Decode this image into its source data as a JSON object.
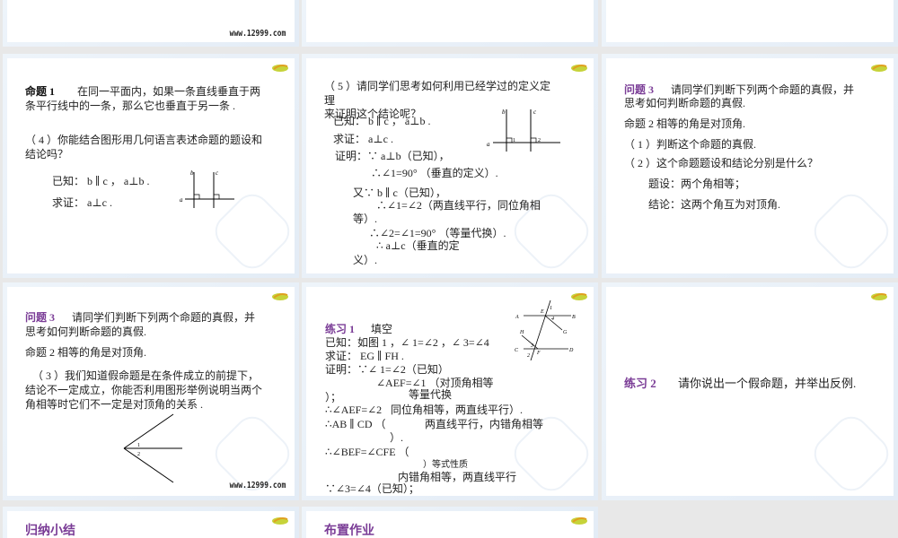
{
  "slides": [
    {
      "site": "www.12999.com"
    },
    {},
    {},
    {
      "title": "命题 1",
      "text1": "在同一平面内，如果一条直线垂直于两",
      "text2": "条平行线中的一条，那么它也垂直于另一条 .",
      "q1": "（ 4 ）你能结合图形用几何语言表述命题的题设和",
      "q2": "结论吗？",
      "known": "已知： b ∥ c ，   a⊥b .",
      "prove": "求证： a⊥c .",
      "labels": [
        "b",
        "c",
        "a"
      ]
    },
    {
      "l1": "（ 5 ）请同学们思考如何利用已经学过的定义定",
      "l2": "理",
      "l3": "来证明这个结论呢？",
      "known": "已知： b ∥ c ， a⊥b .",
      "prove": "求证： a⊥c .",
      "p1": "证明：∵ a⊥b（已知），",
      "p2": "∴∠1=90°  （垂直的定义）.",
      "p3": "又∵ b ∥ c（已知），",
      "p4": "∴∠1=∠2（两直线平行，同位角相",
      "p5": "等）.",
      "p6": "∴∠2=∠1=90° （等量代换）.",
      "p7": "∴ a⊥c（垂直的定",
      "p8": "义）.",
      "labels": [
        "b",
        "c",
        "a",
        "1",
        "2"
      ]
    },
    {
      "title": "问题 3",
      "t1": "请同学们判断下列两个命题的真假，并",
      "t2": "思考如何判断命题的真假.",
      "prop": "命题 2  相等的角是对顶角.",
      "q1": "（ 1 ）判断这个命题的真假.",
      "q2": "（ 2 ）这个命题题设和结论分别是什么？",
      "h": "题设：两个角相等；",
      "c": "结论：这两个角互为对顶角."
    },
    {
      "title": "问题 3",
      "t1": "请同学们判断下列两个命题的真假，并",
      "t2": "思考如何判断命题的真假.",
      "prop": "命题 2  相等的角是对顶角.",
      "q1": "（ 3 ）我们知道假命题是在条件成立的前提下，",
      "q2": "结论不一定成立，你能否利用图形举例说明当两个",
      "q3": "角相等时它们不一定是对顶角的关系 .",
      "labels": [
        "1",
        "2"
      ],
      "site": "www.12999.com"
    },
    {
      "title": "练习 1",
      "sub": "填空",
      "l": [
        "已知：如图 1 ，∠ 1=∠2 ，∠ 3=∠4",
        "求证： EG ∥ FH .",
        "证明：∵∠ 1=∠2（已知）",
        "∠AEF=∠1 （对顶角相等",
        "）；",
        "等量代换",
        "∴∠AEF=∠2",
        "同位角相等，两直线平行）.",
        "∴AB ∥ CD （",
        "两直线平行，内错角相等",
        "）.",
        "∴∠BEF=∠CFE （",
        "）等式性质",
        "内错角相等，两直线平行",
        "∵∠3=∠4（已知）；"
      ],
      "labels": [
        "A",
        "E",
        "1",
        "4",
        "B",
        "G",
        "H",
        "C",
        "3",
        "F",
        "D",
        "2"
      ]
    },
    {
      "title": "练习 2",
      "text": "请你说出一个假命题，并举出反例."
    },
    {
      "title": "归纳小结"
    },
    {
      "title": "布置作业"
    }
  ]
}
